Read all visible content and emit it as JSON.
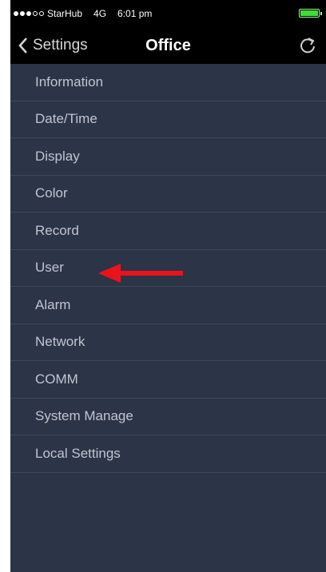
{
  "status_bar": {
    "carrier": "StarHub",
    "network": "4G",
    "time": "6:01 pm",
    "signal_filled": 3,
    "signal_total": 5
  },
  "nav": {
    "back_label": "Settings",
    "title": "Office",
    "refresh_icon": "refresh-icon"
  },
  "menu": {
    "items": [
      {
        "label": "Information"
      },
      {
        "label": "Date/Time"
      },
      {
        "label": "Display"
      },
      {
        "label": "Color"
      },
      {
        "label": "Record"
      },
      {
        "label": "User"
      },
      {
        "label": "Alarm"
      },
      {
        "label": "Network"
      },
      {
        "label": "COMM"
      },
      {
        "label": "System Manage"
      },
      {
        "label": "Local Settings"
      }
    ]
  },
  "annotation": {
    "arrow_color": "#e8141a",
    "points_to": "User"
  },
  "colors": {
    "background": "#2c3448",
    "bar": "#000000",
    "text": "#c0c5cf",
    "battery": "#3ddc3a"
  }
}
